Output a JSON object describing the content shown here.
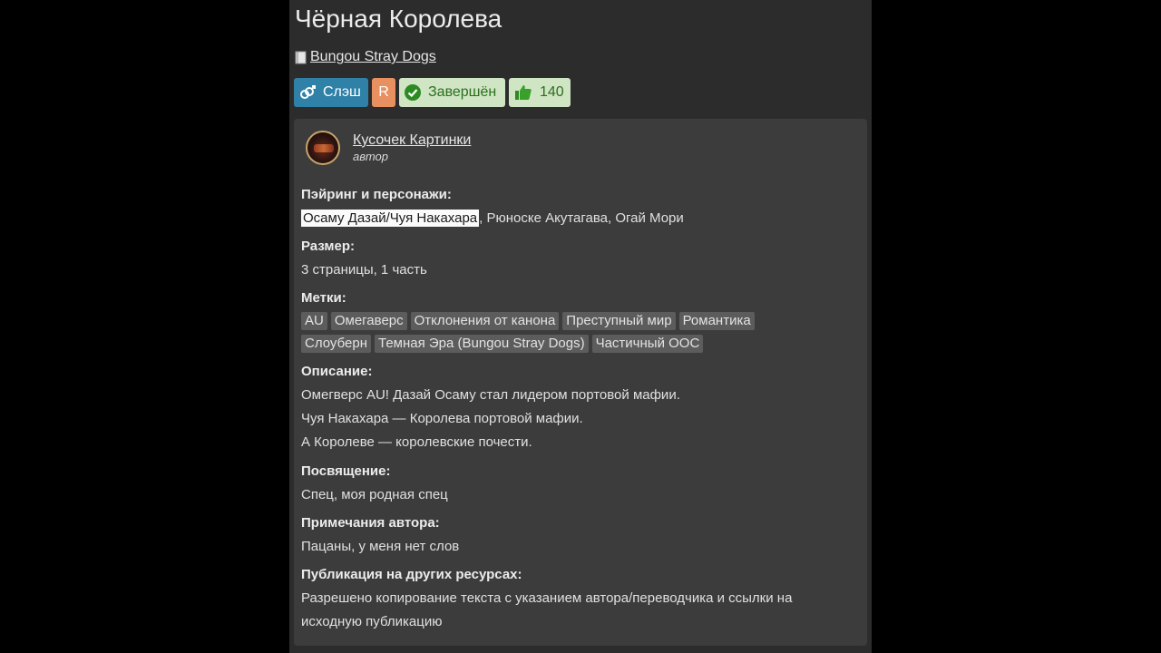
{
  "title": "Чёрная Королева",
  "fandom": {
    "icon": "book-icon",
    "label": "Bungou Stray Dogs"
  },
  "badges": {
    "direction": "Слэш",
    "rating": "R",
    "status": "Завершён",
    "likes": "140",
    "colors": {
      "direction": "#2f81a8",
      "rating": "#e8905f",
      "status_bg": "#cfe5c4",
      "status_text": "#2c6f1e"
    }
  },
  "author": {
    "name": "Кусочек Картинки",
    "role": "автор"
  },
  "sections": {
    "pairing_label": "Пэйринг и персонажи:",
    "pairing_main": "Осаму Дазай/Чуя Накахара",
    "pairing_rest": ", Рюноске Акутагава, Огай Мори",
    "size_label": "Размер:",
    "size_value": "3 страницы, 1 часть",
    "tags_label": "Метки:",
    "tags": [
      "AU",
      "Омегаверс",
      "Отклонения от канона",
      "Преступный мир",
      "Романтика",
      "Слоуберн",
      "Темная Эра (Bungou Stray Dogs)",
      "Частичный ООС"
    ],
    "description_label": "Описание:",
    "description_lines": [
      "Омегверс AU! Дазай Осаму стал лидером портовой мафии.",
      "Чуя Накахара — Королева портовой мафии.",
      "А Королеве — королевские почести."
    ],
    "dedication_label": "Посвящение:",
    "dedication_value": "Спец, моя родная спец",
    "notes_label": "Примечания автора:",
    "notes_value": "Пацаны, у меня нет слов",
    "publication_label": "Публикация на других ресурсах:",
    "publication_lines": [
      "Разрешено копирование текста с указанием автора/переводчика и ссылки на",
      "исходную публикацию"
    ]
  }
}
